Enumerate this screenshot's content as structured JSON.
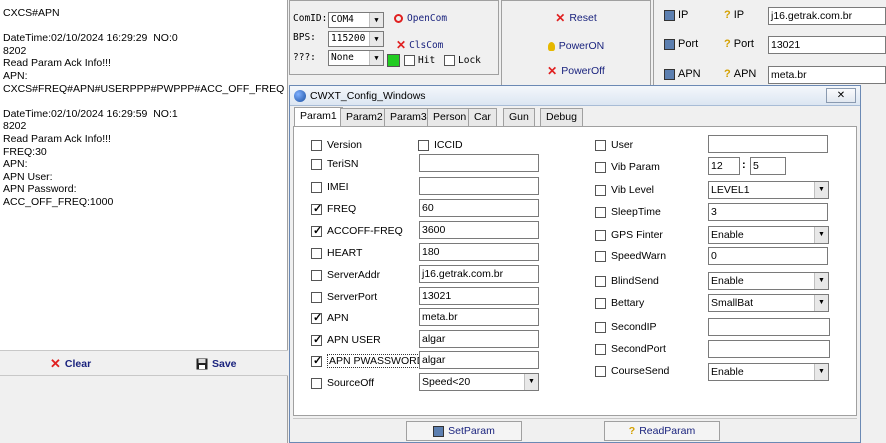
{
  "log": {
    "text": "CXCS#APN\n\nDateTime:02/10/2024 16:29:29  NO:0\n8202\nRead Param Ack Info!!!\nAPN:\nCXCS#FREQ#APN#USERPPP#PWPPP#ACC_OFF_FREQ\n\nDateTime:02/10/2024 16:29:59  NO:1\n8202\nRead Param Ack Info!!!\nFREQ:30\nAPN:\nAPN User:\nAPN Password:\nACC_OFF_FREQ:1000"
  },
  "left_toolbar": {
    "clear_label": "Clear",
    "save_label": "Save"
  },
  "com": {
    "comid_label": "ComID:",
    "comid_value": "COM4",
    "bps_label": "BPS:",
    "bps_value": "115200",
    "other_label": "???:",
    "other_value": "None",
    "open_label": "OpenCom",
    "close_label": "ClsCom",
    "hit_label": "Hit",
    "lock_label": "Lock"
  },
  "power": {
    "reset_label": "Reset",
    "poweron_label": "PowerON",
    "poweroff_label": "PowerOff"
  },
  "ip_panel": {
    "ip_label": "IP",
    "ip_q_label": "IP",
    "ip_value": "j16.getrak.com.br",
    "port_label": "Port",
    "port_q_label": "Port",
    "port_value": "13021",
    "apn_label": "APN",
    "apn_q_label": "APN",
    "apn_value": "meta.br"
  },
  "dialog": {
    "title": "CWXT_Config_Windows",
    "close_symbol": "✕",
    "tabs": [
      "Param1",
      "Param2",
      "Param3",
      "Person",
      "Car",
      "Gun",
      "Debug"
    ],
    "left_fields": [
      {
        "label": "Version",
        "checked": false
      },
      {
        "label": "TeriSN",
        "checked": false,
        "value": ""
      },
      {
        "label": "IMEI",
        "checked": false,
        "value": ""
      },
      {
        "label": "FREQ",
        "checked": true,
        "value": "60"
      },
      {
        "label": "ACCOFF-FREQ",
        "checked": true,
        "value": "3600"
      },
      {
        "label": "HEART",
        "checked": false,
        "value": "180"
      },
      {
        "label": "ServerAddr",
        "checked": false,
        "value": "j16.getrak.com.br"
      },
      {
        "label": "ServerPort",
        "checked": false,
        "value": "13021"
      },
      {
        "label": "APN",
        "checked": true,
        "value": "meta.br"
      },
      {
        "label": "APN USER",
        "checked": true,
        "value": "algar"
      },
      {
        "label": "APN PWASSWORD",
        "checked": true,
        "value": "algar"
      },
      {
        "label": "SourceOff",
        "checked": false,
        "value": "Speed<20"
      }
    ],
    "iccid_label": "ICCID",
    "right_fields": [
      {
        "label": "User",
        "checked": false,
        "value": ""
      },
      {
        "label": "Vib Param",
        "checked": false,
        "value": "12",
        "value2": "5"
      },
      {
        "label": "Vib Level",
        "checked": false,
        "value": "LEVEL1"
      },
      {
        "label": "SleepTime",
        "checked": false,
        "value": "3"
      },
      {
        "label": "GPS Finter",
        "checked": false,
        "value": "Enable"
      },
      {
        "label": "SpeedWarn",
        "checked": false,
        "value": "0"
      },
      {
        "label": "BlindSend",
        "checked": false,
        "value": "Enable"
      },
      {
        "label": "Bettary",
        "checked": false,
        "value": "SmallBat"
      },
      {
        "label": "SecondIP",
        "checked": false,
        "value": ""
      },
      {
        "label": "SecondPort",
        "checked": false,
        "value": ""
      },
      {
        "label": "CourseSend",
        "checked": false,
        "value": "Enable"
      }
    ],
    "vib_separator": ":",
    "setparam_label": "SetParam",
    "readparam_label": "ReadParam"
  },
  "colors": {
    "red_icon": "#e02020",
    "yellow_icon": "#e6b800",
    "link_text": "#1a237e"
  }
}
